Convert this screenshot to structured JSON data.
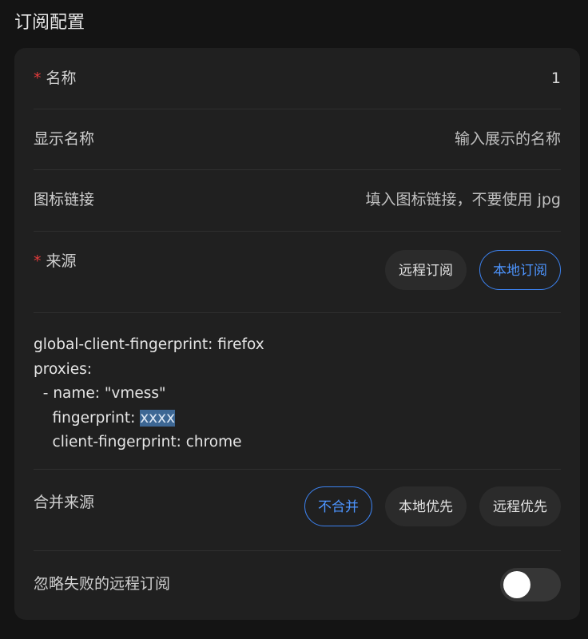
{
  "page": {
    "title": "订阅配置"
  },
  "form": {
    "name": {
      "required_mark": "*",
      "label": "名称",
      "value": "1"
    },
    "display_name": {
      "label": "显示名称",
      "placeholder": "输入展示的名称"
    },
    "icon_link": {
      "label": "图标链接",
      "placeholder": "填入图标链接，不要使用 jpg"
    },
    "source": {
      "required_mark": "*",
      "label": "来源",
      "options": [
        "远程订阅",
        "本地订阅"
      ],
      "selected": "本地订阅"
    },
    "config_text": {
      "line1": "global-client-fingerprint: firefox",
      "line2": "proxies:",
      "line3": "  - name: \"vmess\"",
      "line4_prefix": "    fingerprint: ",
      "line4_selected": "xxxx",
      "line5": "    client-fingerprint: chrome"
    },
    "merge_source": {
      "label": "合并来源",
      "options": [
        "不合并",
        "本地优先",
        "远程优先"
      ],
      "selected": "不合并"
    },
    "ignore_failed": {
      "label": "忽略失败的远程订阅",
      "enabled": false
    }
  },
  "colors": {
    "background": "#141414",
    "card": "#202020",
    "accent": "#3c82f0",
    "required": "#e23b3b"
  }
}
